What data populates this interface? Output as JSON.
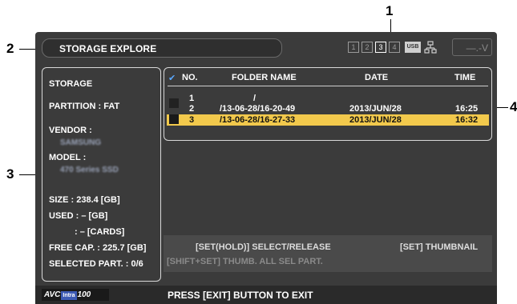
{
  "callouts": [
    "1",
    "2",
    "3",
    "4"
  ],
  "title": "STORAGE EXPLORE",
  "slots": [
    "1",
    "2",
    "3",
    "4"
  ],
  "active_slot": "3",
  "usb_label": "USB",
  "voltage": "—.-V",
  "storage": {
    "heading": "STORAGE",
    "partition": "PARTITION : FAT",
    "vendor_label": "VENDOR :",
    "vendor_value": "SAMSUNG",
    "model_label": "MODEL :",
    "model_value": "470 Series SSD",
    "size": "SIZE : 238.4 [GB]",
    "used": "USED : – [GB]",
    "cards": ": – [CARDS]",
    "free": "FREE CAP. : 225.7 [GB]",
    "selected": "SELECTED PART. : 0/6"
  },
  "table": {
    "check_mark": "✔",
    "headers": [
      "NO.",
      "FOLDER NAME",
      "DATE",
      "TIME"
    ],
    "rows": [
      {
        "no": "1",
        "folder": "/",
        "date": "",
        "time": ""
      },
      {
        "no": "2",
        "folder": "/13-06-28/16-20-49",
        "date": "2013/JUN/28",
        "time": "16:25"
      },
      {
        "no": "3",
        "folder": "/13-06-28/16-27-33",
        "date": "2013/JUN/28",
        "time": "16:32"
      }
    ],
    "selected_row": 3
  },
  "hints": {
    "select": "[SET(HOLD)] SELECT/RELEASE",
    "thumbnail": "[SET] THUMBNAIL",
    "thumb_all": "[SHIFT+SET] THUMB. ALL SEL PART."
  },
  "footer": {
    "logo_avc": "AVC",
    "logo_intra": "Intra",
    "logo_num": "100",
    "exit": "PRESS [EXIT] BUTTON TO EXIT"
  },
  "colors": {
    "screen_bg": "#3b3b3b",
    "highlight": "#f2c94c",
    "check": "#5aa9ff"
  }
}
